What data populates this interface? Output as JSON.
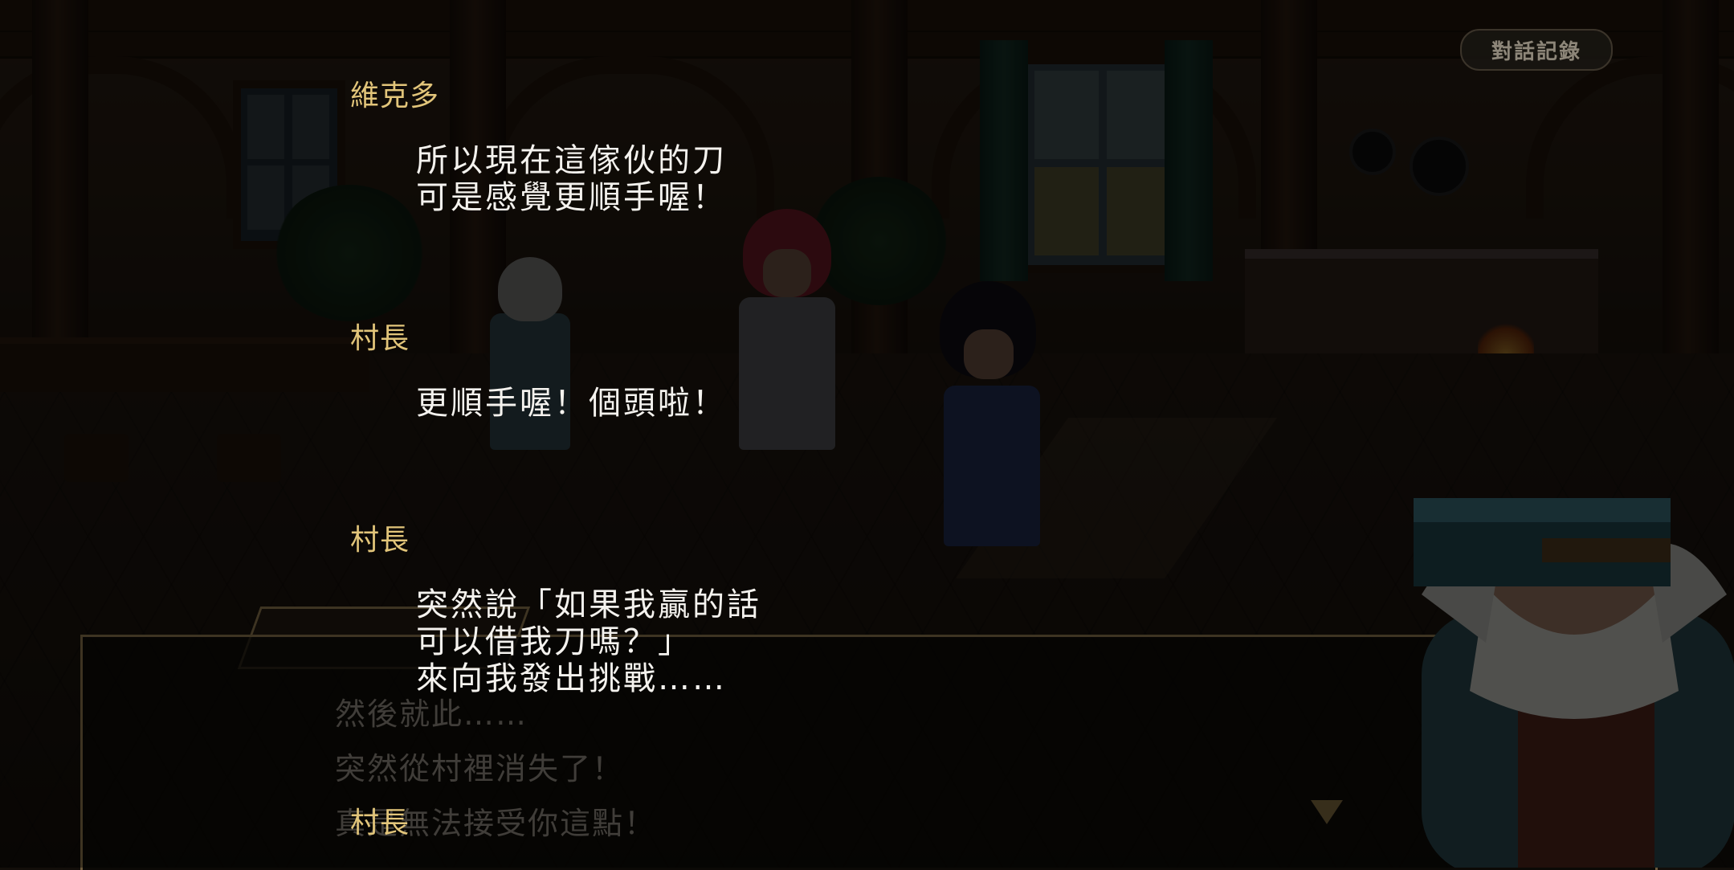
{
  "log_button": {
    "label": "對話記錄"
  },
  "dialogue_box": {
    "lines": [
      "然後就此……",
      "突然從村裡消失了！",
      "真是無法接受你這點！"
    ]
  },
  "log": {
    "entries": [
      {
        "speaker": "維克多",
        "lines": [
          "所以現在這傢伙的刀",
          "可是感覺更順手喔！"
        ]
      },
      {
        "speaker": "村長",
        "lines": [
          "更順手喔！個頭啦！"
        ]
      },
      {
        "speaker": "村長",
        "lines": [
          "突然說「如果我贏的話",
          "可以借我刀嗎？」",
          "來向我發出挑戰……"
        ]
      },
      {
        "speaker": "村長",
        "lines": []
      }
    ]
  },
  "colors": {
    "speaker": "#e2c57a",
    "text": "#f4f2ee"
  }
}
